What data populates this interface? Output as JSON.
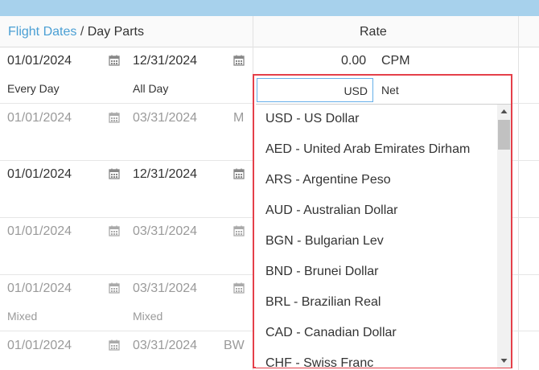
{
  "header": {
    "flight_dates_link": "Flight Dates",
    "separator": "/",
    "day_parts": "Day Parts",
    "rate": "Rate"
  },
  "rows": [
    {
      "start": "01/01/2024",
      "end": "12/31/2024",
      "rate": "0.00",
      "rate_unit": "CPM",
      "days": "Every Day",
      "parts": "All Day"
    },
    {
      "start": "01/01/2024",
      "end": "03/31/2024",
      "extra": "M"
    },
    {
      "start": "01/01/2024",
      "end": "12/31/2024"
    },
    {
      "start": "01/01/2024",
      "end": "03/31/2024"
    },
    {
      "start": "01/01/2024",
      "end": "03/31/2024",
      "days": "Mixed",
      "parts": "Mixed"
    },
    {
      "start": "01/01/2024",
      "end": "03/31/2024",
      "extra": "BW"
    }
  ],
  "currency_select": {
    "value": "USD",
    "type_label": "Net",
    "options": [
      "USD - US Dollar",
      "AED - United Arab Emirates Dirham",
      "ARS - Argentine Peso",
      "AUD - Australian Dollar",
      "BGN - Bulgarian Lev",
      "BND - Brunei Dollar",
      "BRL - Brazilian Real",
      "CAD - Canadian Dollar",
      "CHF - Swiss Franc"
    ]
  },
  "icons": {
    "calendar": "calendar-icon",
    "scroll_up": "scroll-up-arrow-icon",
    "scroll_down": "scroll-down-arrow-icon"
  },
  "colors": {
    "link": "#4a9fd4",
    "highlight_border": "#e5404a",
    "top_bar": "#a7d1ec"
  }
}
